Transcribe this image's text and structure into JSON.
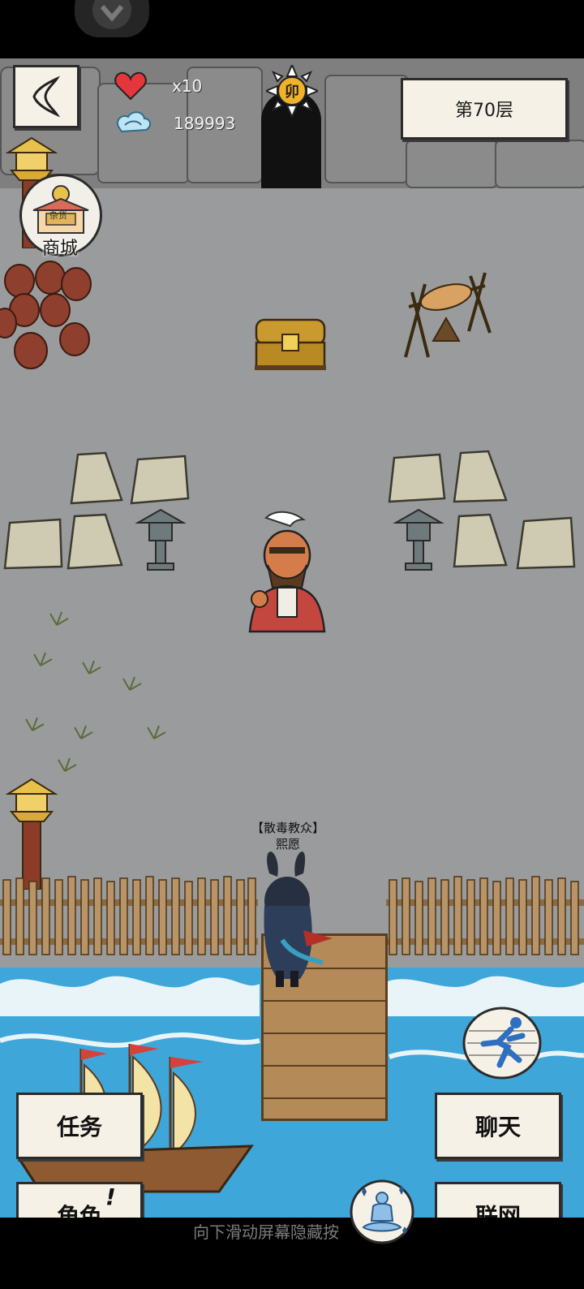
{
  "hud": {
    "lives_count": "x10",
    "currency_amount": "189993",
    "zodiac_badge": "卯",
    "floor_label": "第70层"
  },
  "shop": {
    "sign_text": "杂货",
    "label": "商城"
  },
  "player": {
    "title": "【散毒教众】",
    "name": "熙愿"
  },
  "actions": {
    "task": "任务",
    "character": "角色",
    "chat": "聊天",
    "online": "联网",
    "character_alert": "!"
  },
  "hint_text": "向下滑动屏幕隐藏按",
  "icons": [
    "back-arrow-icon",
    "heart-icon",
    "cloud-coin-icon",
    "sun-badge-icon",
    "shop-icon",
    "sprint-icon",
    "meditate-icon"
  ]
}
